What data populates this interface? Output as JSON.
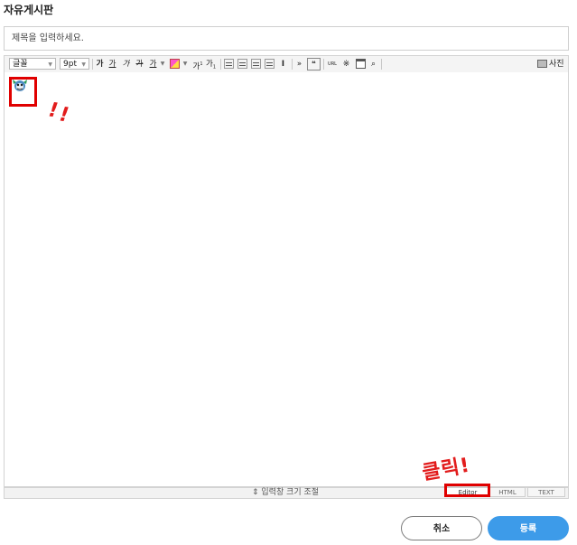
{
  "page": {
    "title": "자유게시판"
  },
  "title_field": {
    "placeholder": "제목을 입력하세요.",
    "value": ""
  },
  "toolbar": {
    "font_family": "글꼴",
    "font_size": "9pt",
    "bold": "가",
    "underline": "가",
    "italic": "가",
    "strike": "가",
    "text_color": "가",
    "superscript": "가",
    "subscript": "가",
    "more": "»",
    "url_label": "URL",
    "photo_label": "사진"
  },
  "editor": {
    "resize_label": "⇕ 입력창 크기 조절",
    "tabs": [
      "Editor",
      "HTML",
      "TEXT"
    ],
    "active_tab": "Editor"
  },
  "annotations": {
    "exclaim_1": "!",
    "exclaim_2": "!",
    "click_note": "클릭!",
    "color": "#e00000"
  },
  "buttons": {
    "cancel": "취소",
    "submit": "등록"
  },
  "colors": {
    "accent": "#3d9be9",
    "highlight": "#e00000"
  }
}
